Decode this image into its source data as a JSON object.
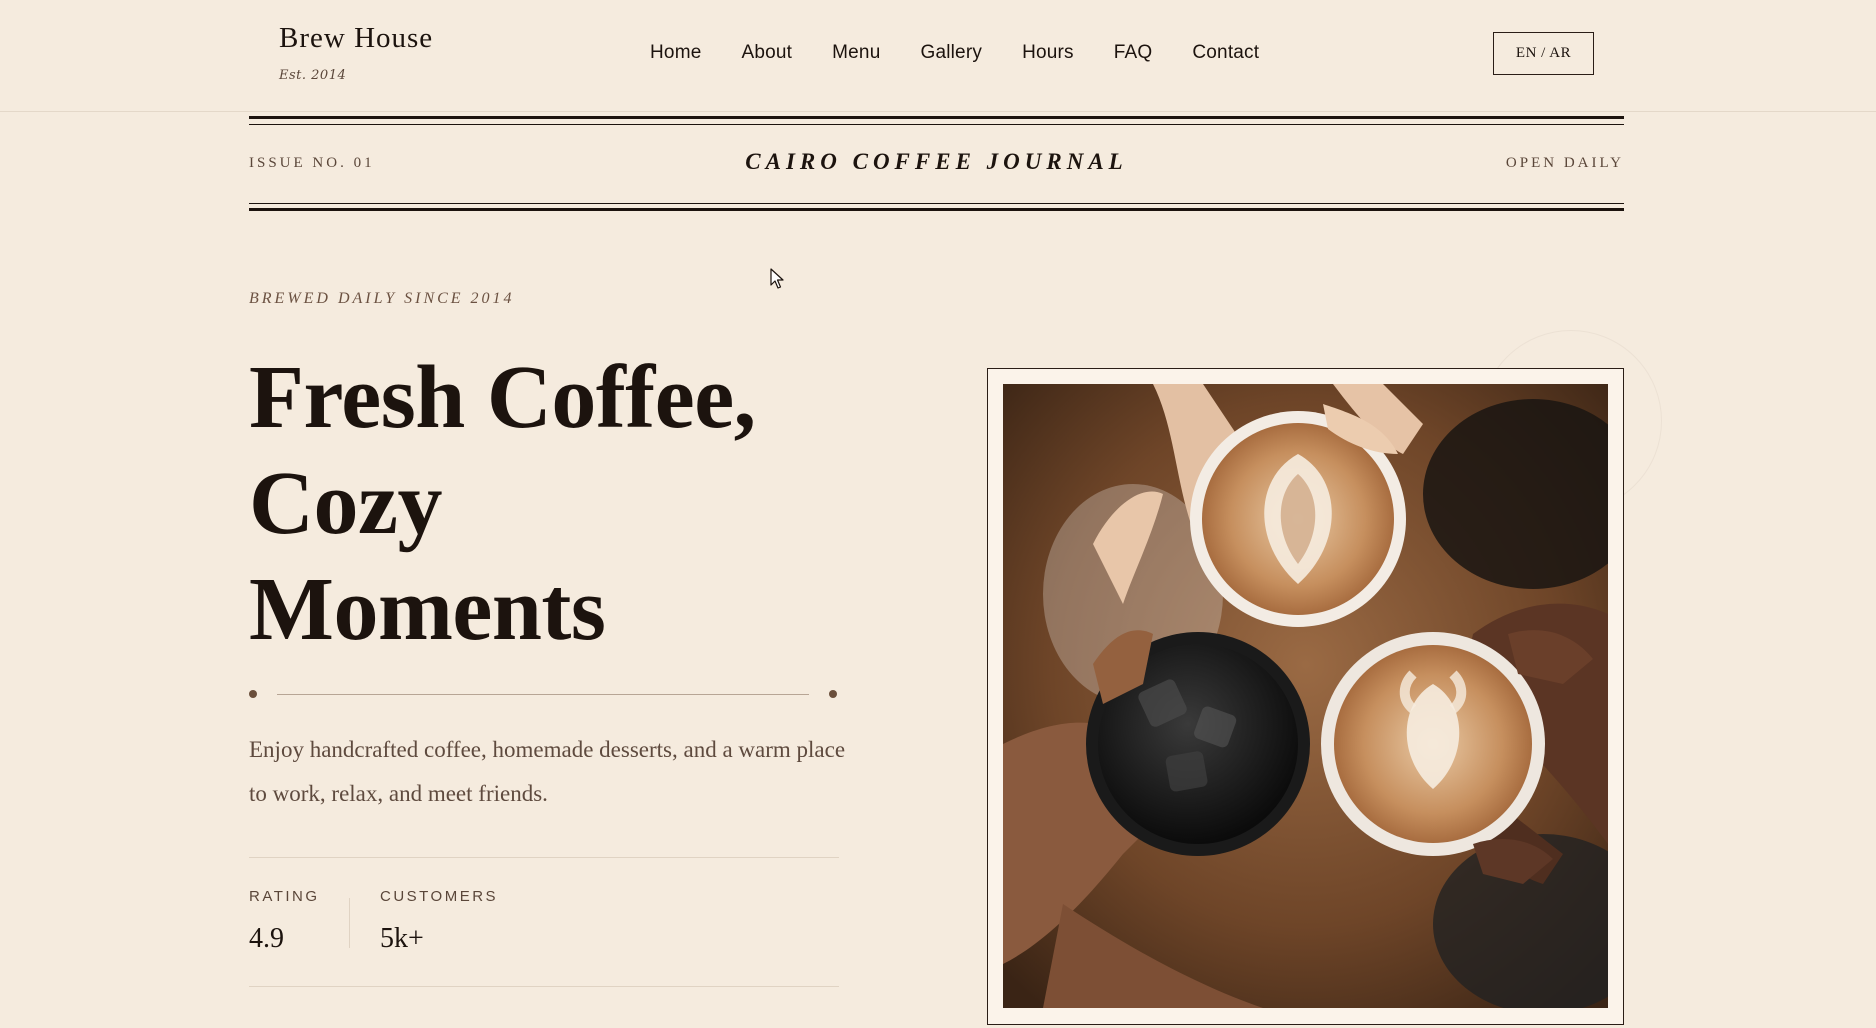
{
  "header": {
    "brand_name": "Brew House",
    "brand_est": "Est. 2014",
    "nav": [
      "Home",
      "About",
      "Menu",
      "Gallery",
      "Hours",
      "FAQ",
      "Contact"
    ],
    "lang_toggle": "EN / AR"
  },
  "band": {
    "issue": "ISSUE NO. 01",
    "journal": "CAIRO COFFEE JOURNAL",
    "open": "OPEN DAILY"
  },
  "hero": {
    "eyebrow": "BREWED DAILY SINCE 2014",
    "headline_1": "Fresh Coffee,",
    "headline_2": "Cozy",
    "headline_3": "Moments",
    "lede": "Enjoy handcrafted coffee, homemade desserts, and a warm place to work, relax, and meet friends."
  },
  "stats": {
    "rating_label": "RATING",
    "rating_value": "4.9",
    "customers_label": "CUSTOMERS",
    "customers_value": "5k+"
  },
  "colors": {
    "background": "#f5ebde",
    "ink": "#1c130e",
    "muted": "#5e4a3e",
    "accent": "#6b4f3c"
  }
}
